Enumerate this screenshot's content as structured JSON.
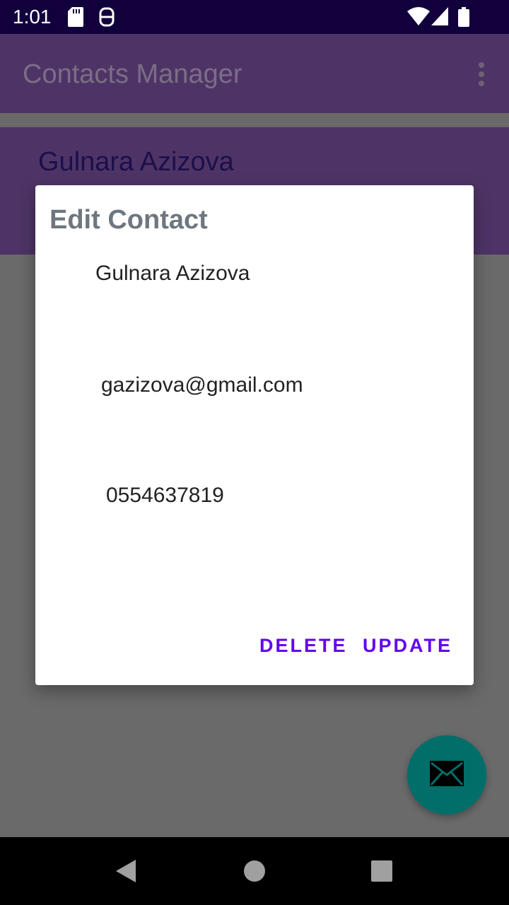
{
  "status_bar": {
    "time": "1:01"
  },
  "app_bar": {
    "title": "Contacts Manager"
  },
  "background_card": {
    "name": "Gulnara Azizova"
  },
  "dialog": {
    "title": "Edit Contact",
    "name_value": "Gulnara Azizova",
    "email_value": "gazizova@gmail.com",
    "phone_value": "0554637819",
    "delete_label": "DELETE",
    "update_label": "UPDATE"
  },
  "icons": {
    "status": [
      "sd-card-icon",
      "assistant-icon",
      "wifi-icon",
      "cell-signal-icon",
      "battery-icon"
    ],
    "appbar": "more-vert-icon",
    "fab": "email-icon",
    "nav": [
      "back-icon",
      "home-icon",
      "recents-icon"
    ]
  },
  "colors": {
    "status_bar": "#12003d",
    "app_bar": "#4e3466",
    "accent": "#6200ee",
    "fab": "#016e6a"
  }
}
